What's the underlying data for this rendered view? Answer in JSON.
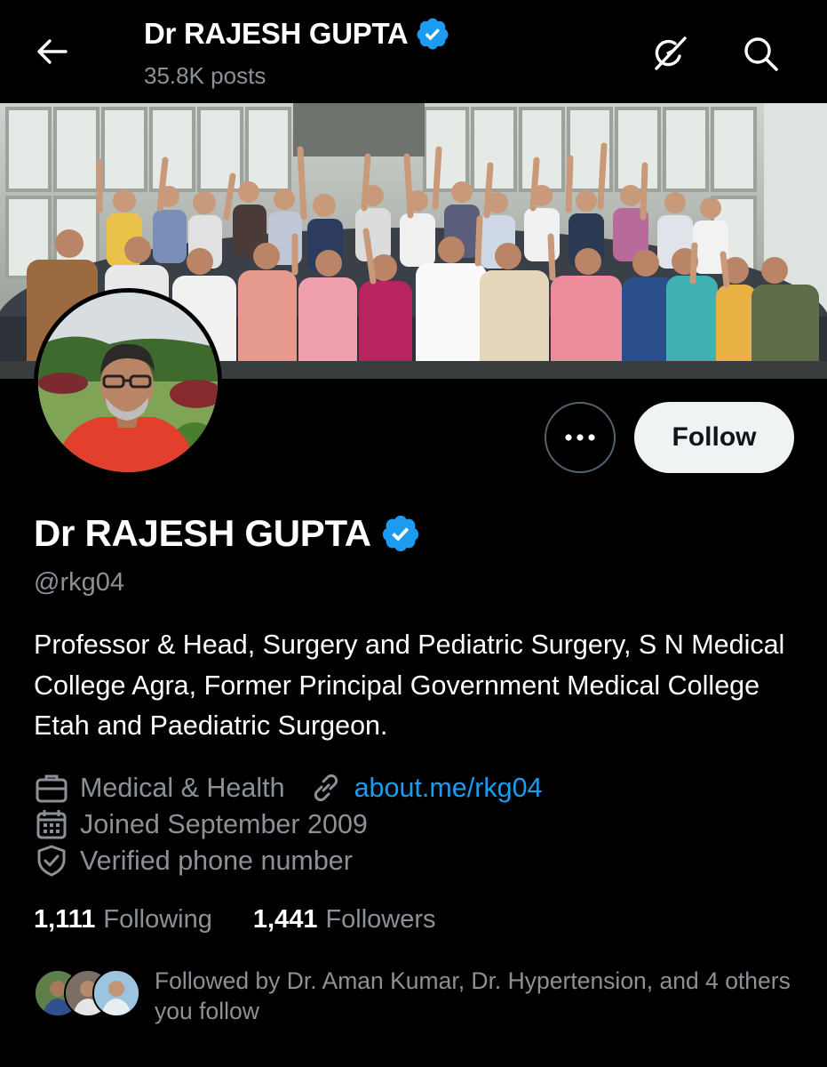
{
  "colors": {
    "background": "#000000",
    "accent": "#1d9bf0",
    "muted_text": "#8b9196",
    "follow_button_bg": "#eff3f4",
    "verified_badge": "#1d9bf0"
  },
  "header": {
    "back_icon": "arrow-left-icon",
    "title": "Dr RAJESH GUPTA",
    "posts_count": "35.8K posts",
    "grok_icon": "grok-icon",
    "search_icon": "search-icon"
  },
  "profile": {
    "banner_icon": "group-photo-banner",
    "avatar_icon": "profile-avatar",
    "more_icon": "more-dots-icon",
    "follow_label": "Follow",
    "display_name": "Dr RAJESH GUPTA",
    "verified_icon": "verified-badge-icon",
    "handle": "@rkg04",
    "bio": "Professor & Head, Surgery and Pediatric Surgery, S N Medical College Agra, Former Principal Government Medical College Etah and Paediatric Surgeon.",
    "category": "Medical & Health",
    "category_icon": "briefcase-icon",
    "website": "about.me/rkg04",
    "website_icon": "link-icon",
    "joined": "Joined September 2009",
    "joined_icon": "calendar-icon",
    "verified_phone": "Verified phone number",
    "verified_phone_icon": "shield-check-icon",
    "following_count": "1,111",
    "following_label": "Following",
    "followers_count": "1,441",
    "followers_label": "Followers",
    "followed_by": "Followed by Dr. Aman Kumar, Dr. Hypertension, and 4 others you follow"
  }
}
